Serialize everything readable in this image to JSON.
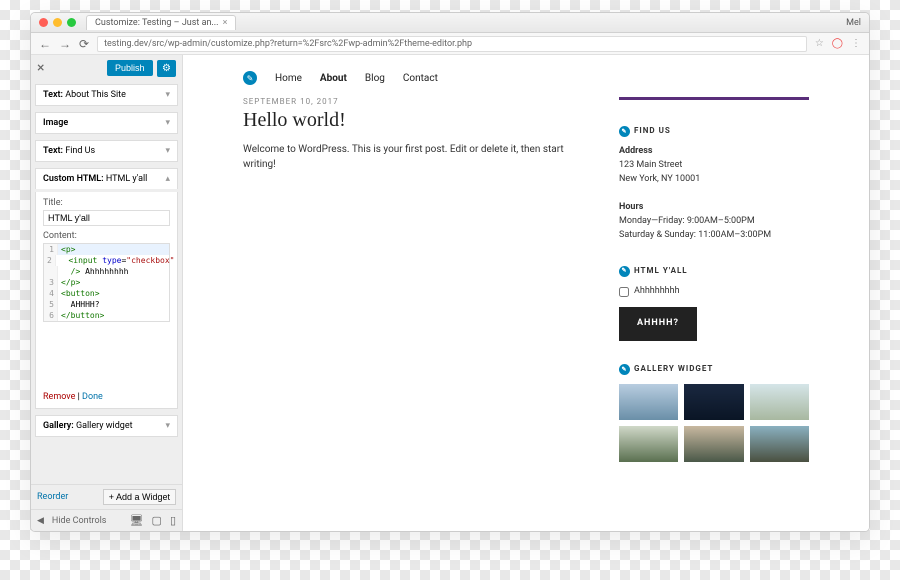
{
  "browser": {
    "tab_title": "Customize: Testing – Just an...",
    "user_label": "Mel",
    "url": "testing.dev/src/wp-admin/customize.php?return=%2Fsrc%2Fwp-admin%2Ftheme-editor.php"
  },
  "sidebar": {
    "publish": "Publish",
    "widgets": [
      {
        "prefix": "Text:",
        "label": "About This Site"
      },
      {
        "prefix": "Image",
        "label": ""
      },
      {
        "prefix": "Text:",
        "label": "Find Us"
      },
      {
        "prefix": "Custom HTML:",
        "label": "HTML y'all"
      }
    ],
    "panel": {
      "title_label": "Title:",
      "title_value": "HTML y'all",
      "content_label": "Content:",
      "code": [
        {
          "n": "1",
          "html": "<span class='tag'>&lt;p&gt;</span>"
        },
        {
          "n": "2",
          "html": "  <span class='tag'>&lt;input</span> <span class='attr'>type</span>=<span class='str'>\"checkbox\"</span>"
        },
        {
          "n": " ",
          "html": "  <span class='tag'>/&gt;</span> Ahhhhhhhh"
        },
        {
          "n": "3",
          "html": "<span class='tag'>&lt;/p&gt;</span>"
        },
        {
          "n": "4",
          "html": "<span class='tag'>&lt;button&gt;</span>"
        },
        {
          "n": "5",
          "html": "  AHHHH?"
        },
        {
          "n": "6",
          "html": "<span class='tag'>&lt;/button&gt;</span>"
        }
      ],
      "remove": "Remove",
      "done": "Done"
    },
    "gallery_widget": {
      "prefix": "Gallery:",
      "label": "Gallery widget"
    },
    "reorder": "Reorder",
    "add_widget": "+  Add a Widget",
    "hide_controls": "Hide Controls"
  },
  "preview": {
    "nav": [
      "Home",
      "About",
      "Blog",
      "Contact"
    ],
    "post": {
      "date": "SEPTEMBER 10, 2017",
      "title": "Hello world!",
      "body": "Welcome to WordPress. This is your first post. Edit or delete it, then start writing!"
    },
    "findus": {
      "title": "FIND US",
      "address_h": "Address",
      "addr1": "123 Main Street",
      "addr2": "New York, NY 10001",
      "hours_h": "Hours",
      "h1": "Monday—Friday: 9:00AM–5:00PM",
      "h2": "Saturday & Sunday: 11:00AM–3:00PM"
    },
    "htmlyall": {
      "title": "HTML Y'ALL",
      "checkbox_label": "Ahhhhhhhh",
      "button": "AHHHH?"
    },
    "gallery": {
      "title": "GALLERY WIDGET"
    }
  }
}
